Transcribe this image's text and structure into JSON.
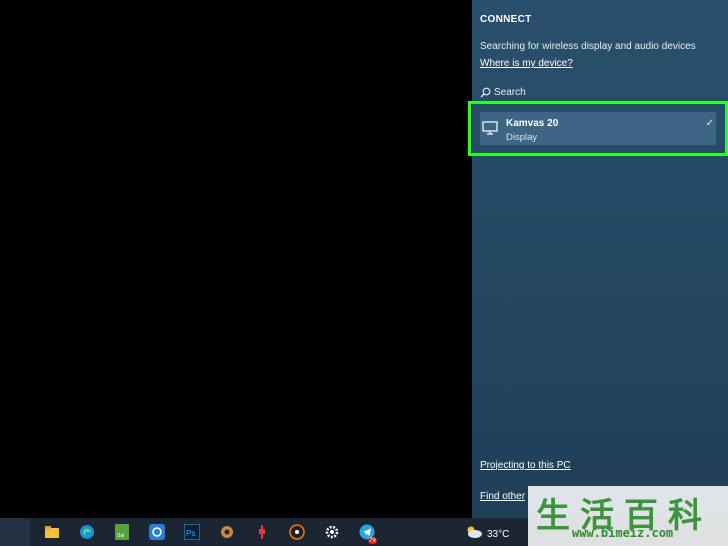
{
  "connect_panel": {
    "title": "CONNECT",
    "status": "Searching for wireless display and audio devices",
    "where_link": "Where is my device?",
    "search_label": "Search",
    "device": {
      "name": "Kamvas 20",
      "type": "Display",
      "check": "✓"
    },
    "projecting_link": "Projecting to this PC",
    "find_other_link": "Find other"
  },
  "taskbar": {
    "weather_temp": "33°C",
    "telegram_badge": "79"
  },
  "watermark": {
    "chars": "生活百科",
    "url": "www.bimeiz.com"
  },
  "colors": {
    "highlight": "#2bff2b",
    "panel_bg": "#274b67",
    "taskbar_bg": "#1c2633"
  }
}
